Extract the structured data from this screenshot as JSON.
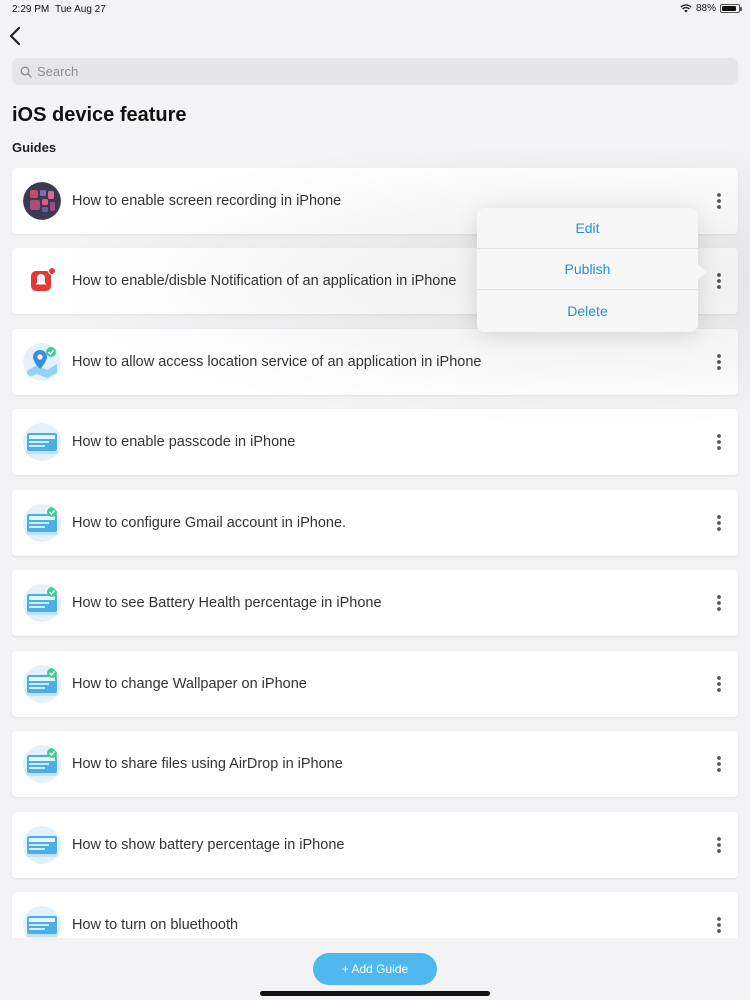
{
  "status": {
    "time": "2:29 PM",
    "date": "Tue Aug 27",
    "battery": "88%",
    "battery_level": 0.88
  },
  "search": {
    "placeholder": "Search"
  },
  "page": {
    "title": "iOS device feature",
    "section": "Guides"
  },
  "guides": [
    {
      "title": "How to enable screen recording in iPhone",
      "icon": "screen-recording-thumb"
    },
    {
      "title": "How to enable/disble Notification of an application in iPhone",
      "icon": "notification-thumb"
    },
    {
      "title": "How to allow access location service of an application in iPhone",
      "icon": "location-thumb"
    },
    {
      "title": "How to enable passcode in iPhone",
      "icon": "guide-thumb"
    },
    {
      "title": "How to configure Gmail account in iPhone.",
      "icon": "guide-check-thumb"
    },
    {
      "title": "How to see Battery Health percentage in iPhone",
      "icon": "guide-check-thumb"
    },
    {
      "title": "How to change Wallpaper on iPhone",
      "icon": "guide-check-thumb"
    },
    {
      "title": "How to share files using AirDrop in iPhone",
      "icon": "guide-check-thumb"
    },
    {
      "title": "How to show battery percentage in iPhone",
      "icon": "guide-thumb"
    },
    {
      "title": "How to turn on bluethooth",
      "icon": "guide-thumb"
    }
  ],
  "popover": {
    "edit": "Edit",
    "publish": "Publish",
    "delete": "Delete"
  },
  "add_button": "+ Add Guide",
  "colors": {
    "accent": "#2a8fd4",
    "button": "#4fb8ee",
    "background": "#f3f3f5"
  }
}
